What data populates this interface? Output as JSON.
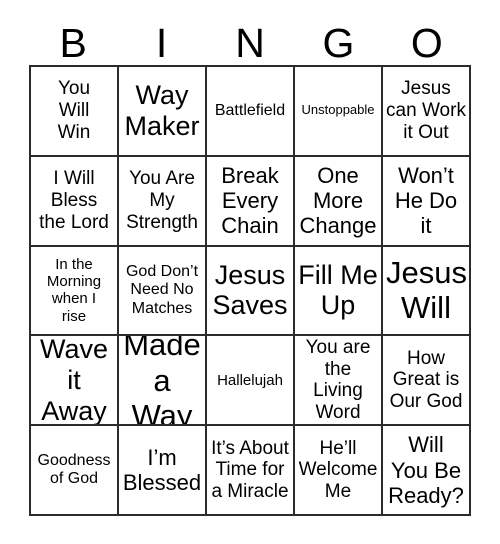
{
  "card": {
    "type": "bingo-card",
    "columns": 5,
    "rows": 5,
    "text_color": "#000000",
    "background_color": "#ffffff",
    "border_color": "#2b2b2b",
    "header": {
      "letters": [
        "B",
        "I",
        "N",
        "G",
        "O"
      ]
    },
    "cells": [
      [
        {
          "text": "You\nWill\nWin",
          "size": "fs-md"
        },
        {
          "text": "Way\nMaker",
          "size": "fs-xl"
        },
        {
          "text": "Battlefield",
          "size": "fs-smd"
        },
        {
          "text": "Unstoppable",
          "size": "fs-xs"
        },
        {
          "text": "Jesus\ncan Work\nit Out",
          "size": "fs-md"
        }
      ],
      [
        {
          "text": "I Will\nBless\nthe Lord",
          "size": "fs-md"
        },
        {
          "text": "You Are\nMy\nStrength",
          "size": "fs-md"
        },
        {
          "text": "Break\nEvery\nChain",
          "size": "fs-lg"
        },
        {
          "text": "One\nMore\nChange",
          "size": "fs-lg"
        },
        {
          "text": "Won’t\nHe Do\nit",
          "size": "fs-lg"
        }
      ],
      [
        {
          "text": "In the\nMorning\nwhen I\nrise",
          "size": "fs-sm"
        },
        {
          "text": "God Don’t\nNeed No\nMatches",
          "size": "fs-smd"
        },
        {
          "text": "Jesus\nSaves",
          "size": "fs-xl"
        },
        {
          "text": "Fill Me\nUp",
          "size": "fs-xl"
        },
        {
          "text": "Jesus\nWill",
          "size": "fs-xxl"
        }
      ],
      [
        {
          "text": "Wave\nit Away",
          "size": "fs-xl"
        },
        {
          "text": "Made\na Way",
          "size": "fs-xxl"
        },
        {
          "text": "Hallelujah",
          "size": "fs-sm"
        },
        {
          "text": "You are\nthe Living\nWord",
          "size": "fs-md"
        },
        {
          "text": "How\nGreat is\nOur God",
          "size": "fs-md"
        }
      ],
      [
        {
          "text": "Goodness\nof God",
          "size": "fs-smd"
        },
        {
          "text": "I’m\nBlessed",
          "size": "fs-lg"
        },
        {
          "text": "It’s About\nTime for\na Miracle",
          "size": "fs-md"
        },
        {
          "text": "He’ll\nWelcome\nMe",
          "size": "fs-md"
        },
        {
          "text": "Will\nYou Be\nReady?",
          "size": "fs-lg"
        }
      ]
    ]
  }
}
